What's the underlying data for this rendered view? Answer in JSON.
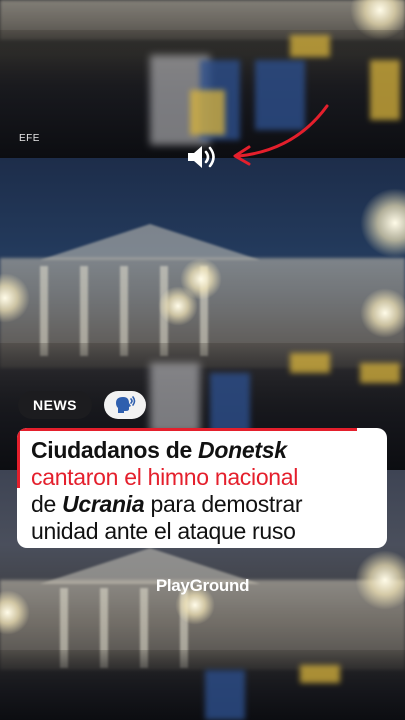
{
  "video": {
    "credit": "EFE",
    "sound_icon": "speaker-icon",
    "arrow_icon": "red-arrow-icon"
  },
  "tags": {
    "news_label": "NEWS",
    "voice_icon": "speaking-head-icon"
  },
  "headline": {
    "line1_prefix": "Ciudadanos de ",
    "line1_emph": "Donetsk",
    "line2": "cantaron el himno nacional",
    "line3_prefix": "de ",
    "line3_emph": "Ucrania",
    "line3_suffix": " para demostrar",
    "line4": "unidad ante el ataque ruso"
  },
  "brand": {
    "logo": "PlayGround"
  },
  "colors": {
    "accent": "#e41f2c",
    "card": "#ffffff",
    "pill_dark": "#1c1c1f"
  }
}
